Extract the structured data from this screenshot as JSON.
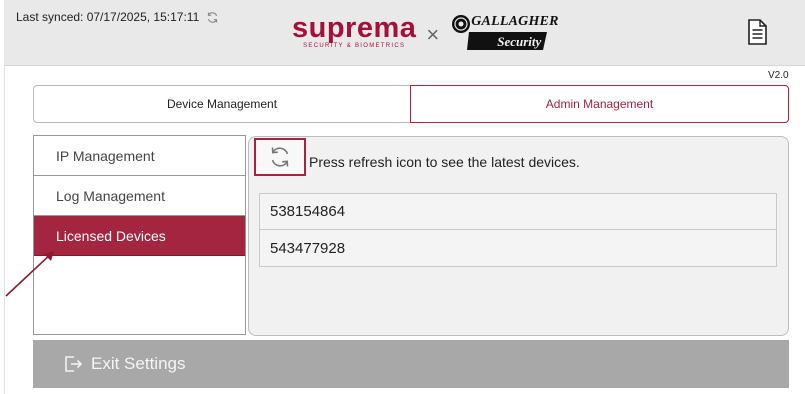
{
  "header": {
    "sync_text": "Last synced: 07/17/2025, 15:17:11",
    "logo_primary": "suprema",
    "logo_primary_tagline": "SECURITY & BIOMETRICS",
    "logo_separator": "×",
    "logo_secondary": "GALLAGHER",
    "logo_secondary_tagline": "Security",
    "sync_icon": "sync-icon",
    "doc_icon": "document-icon"
  },
  "version": "V2.0",
  "tabs": [
    {
      "label": "Device Management",
      "active": false
    },
    {
      "label": "Admin Management",
      "active": true
    }
  ],
  "side_menu": {
    "items": [
      {
        "label": "IP Management",
        "active": false
      },
      {
        "label": "Log Management",
        "active": false
      },
      {
        "label": "Licensed Devices",
        "active": true
      }
    ]
  },
  "content": {
    "refresh_icon": "refresh-icon",
    "refresh_hint": "Press refresh icon to see the latest devices.",
    "devices": [
      "538154864",
      "543477928"
    ]
  },
  "footer": {
    "exit_label": "Exit Settings",
    "exit_icon": "logout-icon"
  },
  "colors": {
    "accent": "#a3253f",
    "brand_red": "#a50f3c",
    "header_bg": "#e9e9e9",
    "exit_bar": "#a8a8a8"
  }
}
